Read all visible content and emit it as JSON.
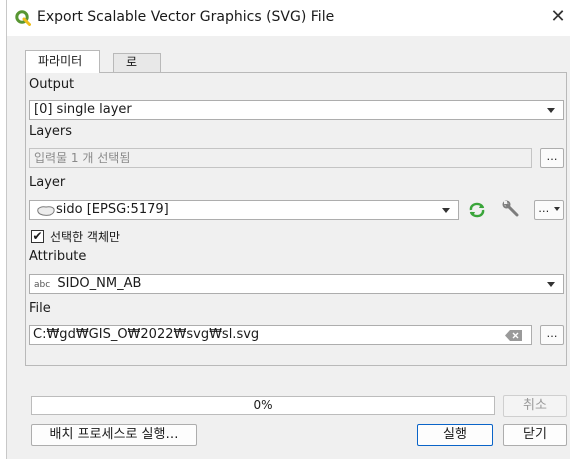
{
  "window": {
    "title": "Export Scalable Vector Graphics (SVG) File",
    "close_glyph": "✕"
  },
  "tabs": [
    {
      "label": "파라미터",
      "active": true
    },
    {
      "label": "로그",
      "active": false
    }
  ],
  "params": {
    "output": {
      "label": "Output",
      "value": "[0] single layer"
    },
    "layers": {
      "label": "Layers",
      "value": "입력물 1 개 선택됨",
      "button": "…"
    },
    "layer": {
      "label": "Layer",
      "value": "sido [EPSG:5179]",
      "button": "…"
    },
    "selected_only": {
      "label": "선택한 객체만",
      "checked": true,
      "check_glyph": "✔"
    },
    "attribute": {
      "label": "Attribute",
      "type_tag": "abc",
      "value": "SIDO_NM_AB"
    },
    "file": {
      "label": "File",
      "value": "C:₩gd₩GIS_O₩2022₩svg₩sl.svg",
      "button": "…"
    }
  },
  "progress": {
    "text": "0%",
    "value": 0
  },
  "buttons": {
    "cancel": "취소",
    "batch": "배치 프로세스로 실행…",
    "run": "실행",
    "close": "닫기"
  },
  "colors": {
    "accent": "#0a64c8",
    "qgis_green": "#589632",
    "qgis_yellow": "#eebe1a"
  }
}
